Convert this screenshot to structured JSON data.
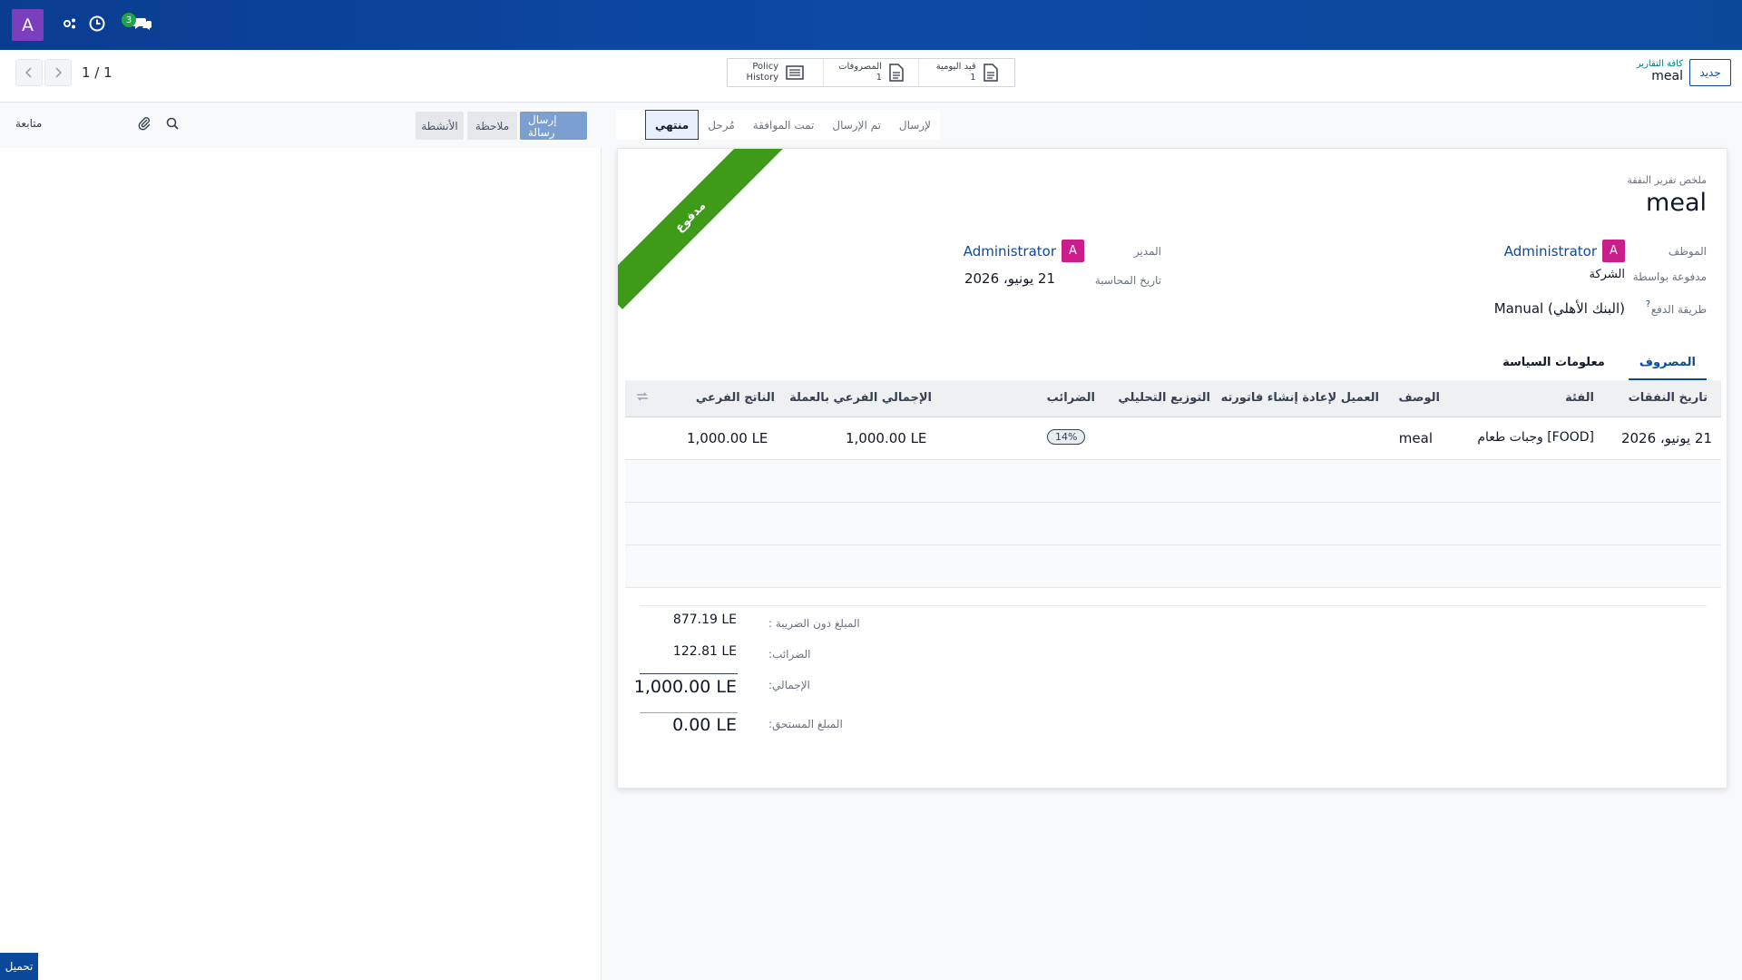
{
  "navbar": {
    "avatar_letter": "A",
    "messages_count": "3",
    "icons": [
      "activity-icon",
      "clock-icon",
      "chat-icon"
    ]
  },
  "control": {
    "pager": "1 / 1",
    "breadcrumb_parent": "كافة التقارير",
    "breadcrumb_current": "meal",
    "new_label": "جديد",
    "smart_buttons": [
      {
        "label": "قيد اليومية",
        "value": "1",
        "icon": "document-icon"
      },
      {
        "label": "المصروفات",
        "value": "1",
        "icon": "document-icon"
      },
      {
        "label": "Policy",
        "value": "History",
        "icon": "list-icon"
      }
    ]
  },
  "chatter": {
    "follow_label": "متابعة",
    "send_message": "إرسال رسالة",
    "log_note": "ملاحظة",
    "activities": "الأنشطة",
    "download": "تحميل"
  },
  "status": {
    "stages": [
      "لإرسال",
      "تم الإرسال",
      "تمت الموافقة",
      "مُرحل",
      "منتهي"
    ],
    "active_stage": "منتهي"
  },
  "sheet": {
    "ribbon": "مدفوع",
    "summary_label": "ملخص تقرير النفقة",
    "title": "meal",
    "employee_label": "الموظف",
    "employee_avatar": "A",
    "employee_value": "Administrator",
    "paid_by_label": "مدفوعة بواسطة",
    "paid_by_value": "الشركة",
    "payment_method_label": "طريقة الدفع",
    "payment_method_help": "?",
    "payment_method_value": "Manual (البنك الأهلي)",
    "manager_label": "المدير",
    "manager_avatar": "A",
    "manager_value": "Administrator",
    "accounting_date_label": "تاريخ المحاسبة",
    "accounting_date_value": "21 يونيو، 2026",
    "tabs": [
      "المصروف",
      "معلومات السياسة"
    ],
    "table": {
      "headers": [
        "تاريخ النفقات",
        "الفئة",
        "الوصف",
        "العميل لإعادة إنشاء فاتورته",
        "التوزيع التحليلي",
        "الضرائب",
        "الإجمالي الفرعي بالعملة",
        "الناتج الفرعي"
      ],
      "rows": [
        {
          "date": "21 يونيو، 2026",
          "category": "[FOOD] وجبات طعام",
          "description": "meal",
          "customer": "",
          "analytic": "",
          "taxes": "14%",
          "subtotal_currency": "1,000.00 LE",
          "subtotal": "1,000.00 LE"
        }
      ]
    },
    "totals": {
      "untaxed_label": "المبلغ دون الضريبة :",
      "untaxed_value": "877.19 LE",
      "taxes_label": "الضرائب:",
      "taxes_value": "122.81 LE",
      "total_label": "الإجمالي:",
      "total_value": "1,000.00 LE",
      "due_label": "المبلغ المستحق:",
      "due_value": "0.00 LE"
    }
  }
}
